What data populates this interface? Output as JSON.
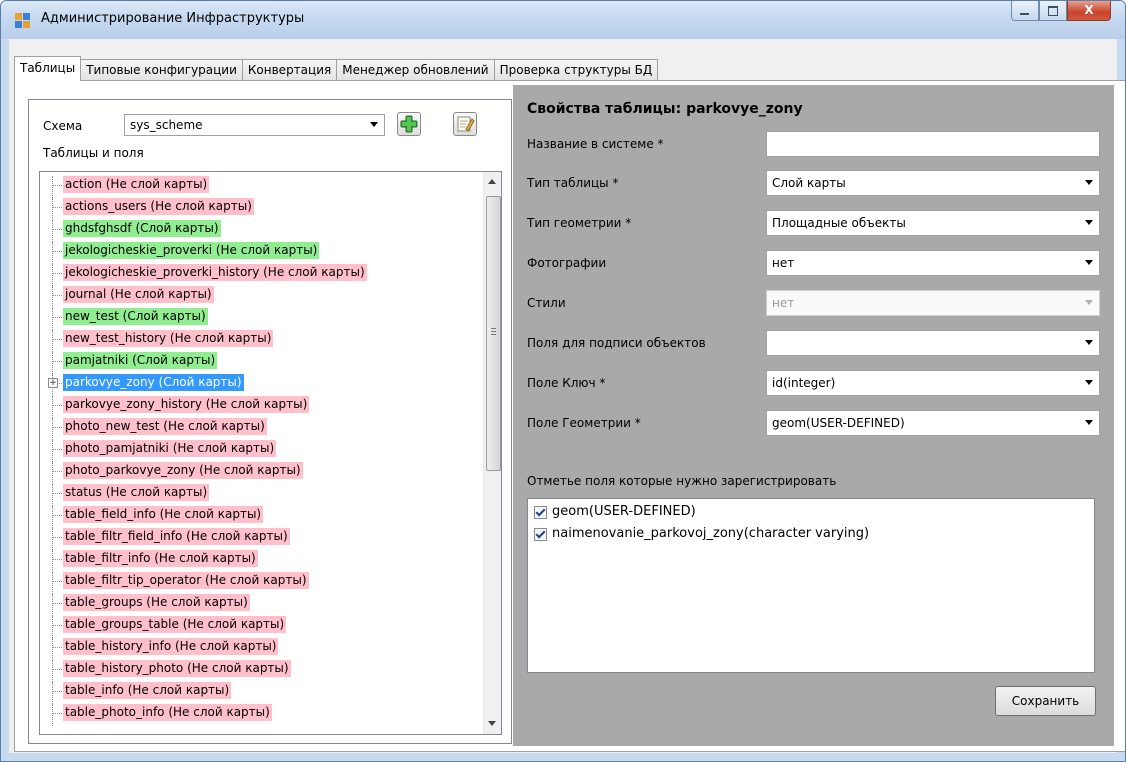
{
  "window": {
    "title": "Администрирование Инфраструктуры",
    "close_glyph": "X"
  },
  "tabs": [
    {
      "label": "Таблицы",
      "active": true
    },
    {
      "label": "Типовые конфигурации",
      "active": false
    },
    {
      "label": "Конвертация",
      "active": false
    },
    {
      "label": "Менеджер обновлений",
      "active": false
    },
    {
      "label": "Проверка структуры БД",
      "active": false
    }
  ],
  "left": {
    "schema_label": "Схема",
    "schema_value": "sys_scheme",
    "add_icon": "plus-icon",
    "edit_icon": "edit-icon",
    "tree_label": "Таблицы и поля",
    "nodes": [
      {
        "text": "action (Не слой карты)",
        "status": "pink"
      },
      {
        "text": "actions_users (Не слой карты)",
        "status": "pink"
      },
      {
        "text": "ghdsfghsdf (Слой карты)",
        "status": "green"
      },
      {
        "text": "jekologicheskie_proverki (Не слой карты)",
        "status": "green"
      },
      {
        "text": "jekologicheskie_proverki_history (Не слой карты)",
        "status": "pink"
      },
      {
        "text": "journal (Не слой карты)",
        "status": "pink"
      },
      {
        "text": "new_test (Слой карты)",
        "status": "green"
      },
      {
        "text": "new_test_history (Не слой карты)",
        "status": "pink"
      },
      {
        "text": "pamjatniki (Слой карты)",
        "status": "green"
      },
      {
        "text": "parkovye_zony (Слой карты)",
        "status": "selected",
        "expandable": true
      },
      {
        "text": "parkovye_zony_history (Не слой карты)",
        "status": "pink"
      },
      {
        "text": "photo_new_test (Не слой карты)",
        "status": "pink"
      },
      {
        "text": "photo_pamjatniki (Не слой карты)",
        "status": "pink"
      },
      {
        "text": "photo_parkovye_zony (Не слой карты)",
        "status": "pink"
      },
      {
        "text": "status (Не слой карты)",
        "status": "pink"
      },
      {
        "text": "table_field_info (Не слой карты)",
        "status": "pink"
      },
      {
        "text": "table_filtr_field_info (Не слой карты)",
        "status": "pink"
      },
      {
        "text": "table_filtr_info (Не слой карты)",
        "status": "pink"
      },
      {
        "text": "table_filtr_tip_operator (Не слой карты)",
        "status": "pink"
      },
      {
        "text": "table_groups (Не слой карты)",
        "status": "pink"
      },
      {
        "text": "table_groups_table (Не слой карты)",
        "status": "pink"
      },
      {
        "text": "table_history_info (Не слой карты)",
        "status": "pink"
      },
      {
        "text": "table_history_photo (Не слой карты)",
        "status": "pink"
      },
      {
        "text": "table_info (Не слой карты)",
        "status": "pink"
      },
      {
        "text": "table_photo_info (Не слой карты)",
        "status": "pink"
      }
    ],
    "colors": {
      "pink": "#ffc0cb",
      "green": "#90ee90",
      "selected": "#3399ff"
    }
  },
  "right": {
    "header": "Свойства таблицы: parkovye_zony",
    "fields": [
      {
        "label": "Название в системе *",
        "type": "text",
        "value": ""
      },
      {
        "label": "Тип таблицы *",
        "type": "combo",
        "value": "Слой карты"
      },
      {
        "label": "Тип геометрии *",
        "type": "combo",
        "value": "Площадные объекты"
      },
      {
        "label": "Фотографии",
        "type": "combo",
        "value": "нет"
      },
      {
        "label": "Стили",
        "type": "combo",
        "value": "нет",
        "disabled": true
      },
      {
        "label": "Поля для подписи объектов",
        "type": "combo",
        "value": ""
      },
      {
        "label": "Поле Ключ *",
        "type": "combo",
        "value": "id(integer)"
      },
      {
        "label": "Поле Геометрии *",
        "type": "combo",
        "value": "geom(USER-DEFINED)"
      }
    ],
    "fields_label": "Отметье поля которые нужно зарегистрировать",
    "checklist": [
      {
        "label": "geom(USER-DEFINED)",
        "checked": true
      },
      {
        "label": "naimenovanie_parkovoj_zony(character varying)",
        "checked": true
      }
    ],
    "save_label": "Сохранить"
  }
}
